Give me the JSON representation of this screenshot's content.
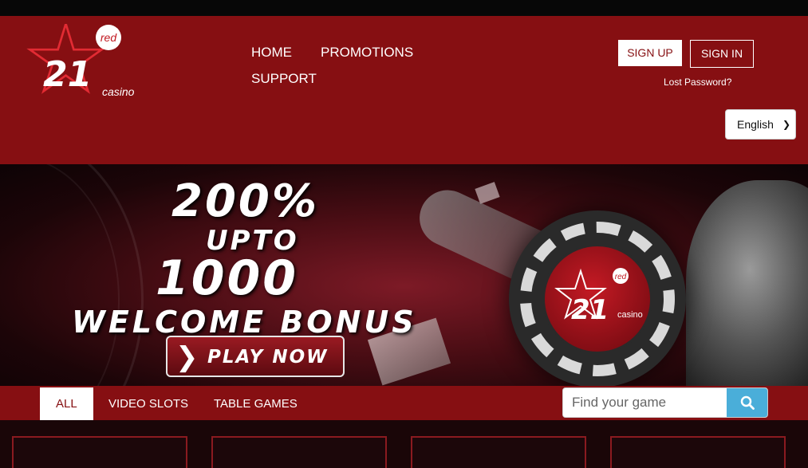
{
  "brand": {
    "logo_number": "21",
    "logo_badge": "red",
    "logo_word": "casino",
    "colors": {
      "header": "#860f12",
      "accent": "#4aaed9",
      "topbar": "#070707"
    }
  },
  "nav": {
    "items": [
      {
        "label": "HOME"
      },
      {
        "label": "PROMOTIONS"
      },
      {
        "label": "SUPPORT"
      }
    ]
  },
  "auth": {
    "signup_label": "SIGN UP",
    "signin_label": "SIGN IN",
    "lost_password": "Lost Password?"
  },
  "language": {
    "selected": "English"
  },
  "banner": {
    "line1": "200%",
    "line2": "UPTO",
    "line3": "1000",
    "line4": "WELCOME BONUS",
    "cta": "PLAY NOW"
  },
  "filters": {
    "tabs": [
      {
        "label": "ALL",
        "active": true
      },
      {
        "label": "VIDEO SLOTS",
        "active": false
      },
      {
        "label": "TABLE GAMES",
        "active": false
      }
    ],
    "search_placeholder": "Find your game",
    "search_icon": "search-icon"
  }
}
